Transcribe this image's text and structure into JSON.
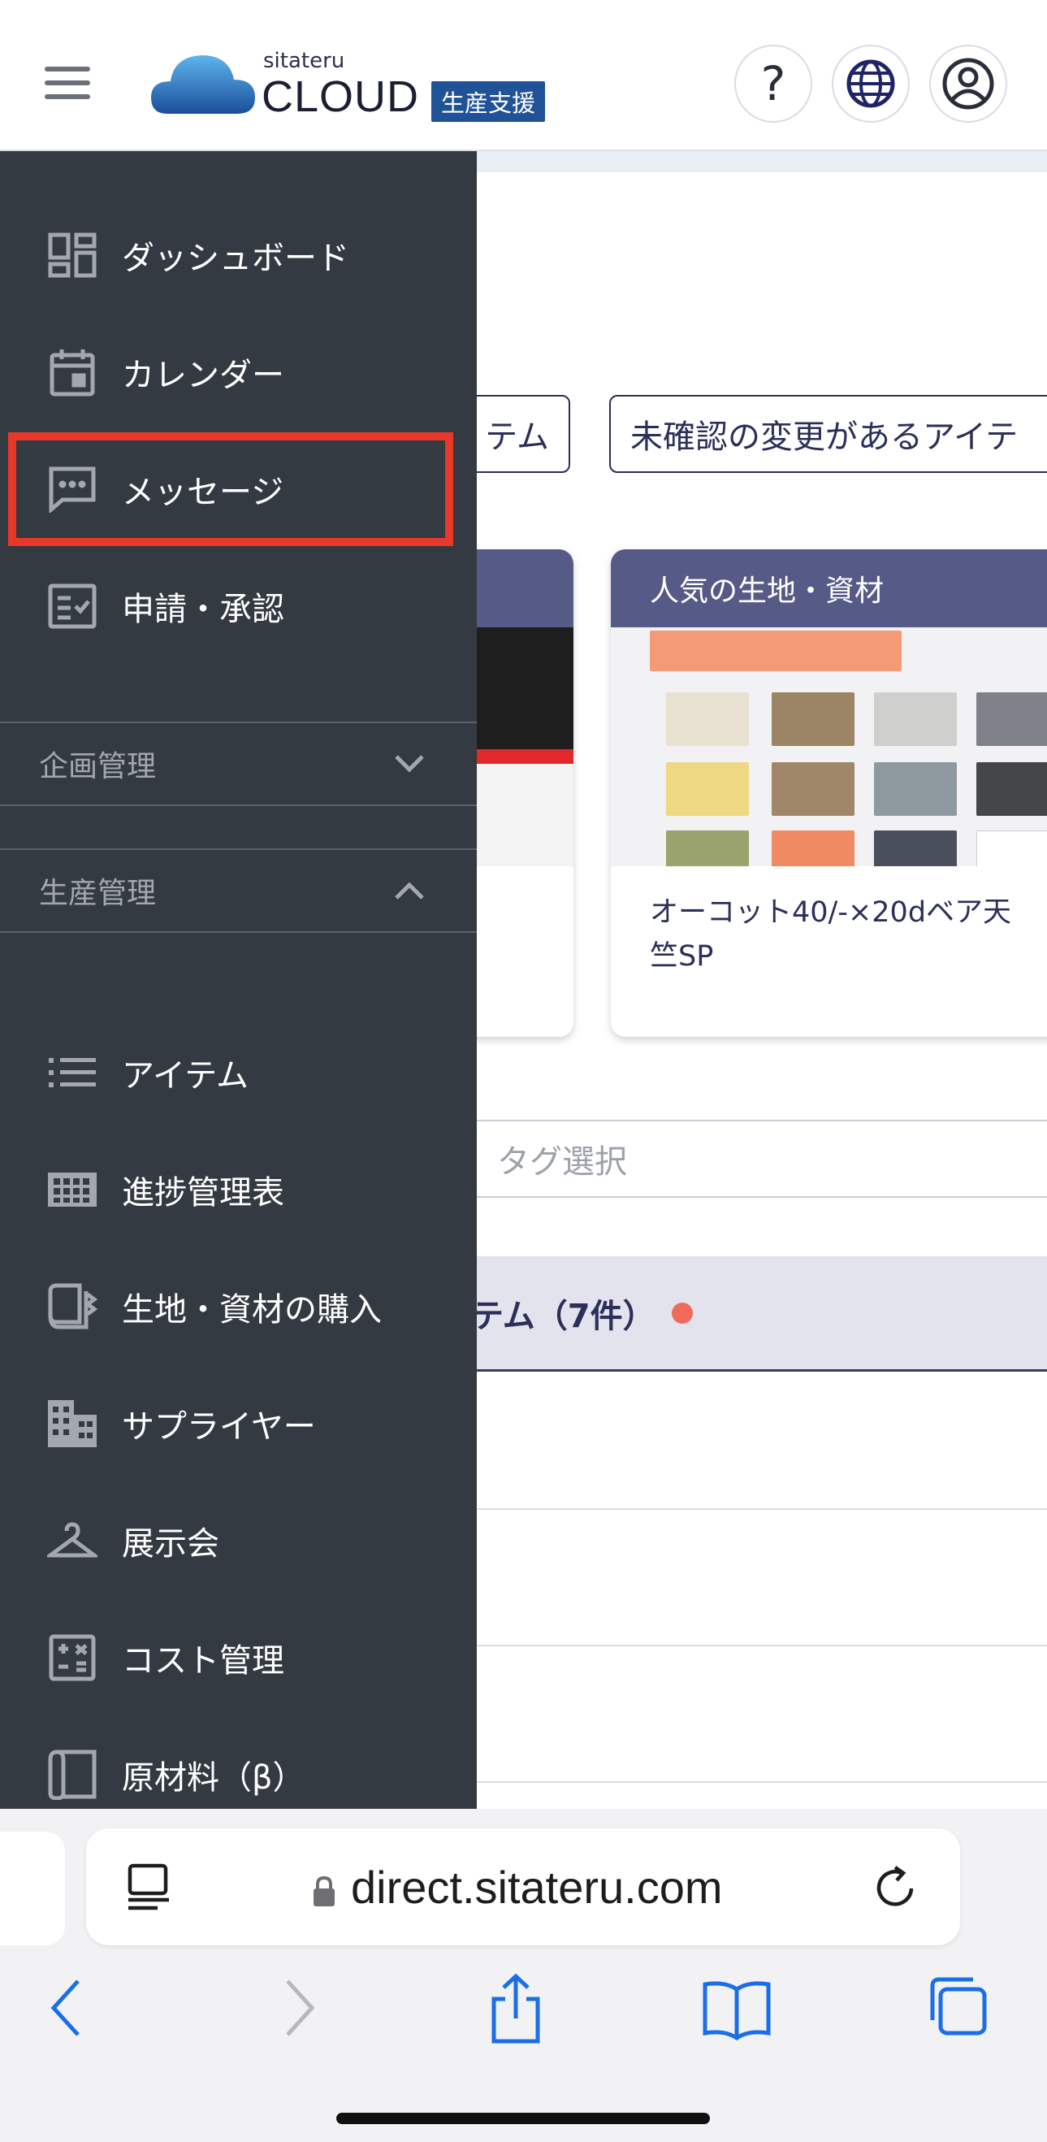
{
  "header": {
    "logo_small": "sitateru",
    "logo_big": "CLOUD",
    "logo_badge": "生産支援",
    "help_label": "?"
  },
  "sidebar": {
    "items_top": [
      {
        "label": "ダッシュボード",
        "icon": "dashboard-icon"
      },
      {
        "label": "カレンダー",
        "icon": "calendar-icon"
      },
      {
        "label": "メッセージ",
        "icon": "message-icon"
      },
      {
        "label": "申請・承認",
        "icon": "approval-icon"
      }
    ],
    "groups": [
      {
        "label": "企画管理",
        "state": "collapsed"
      },
      {
        "label": "生産管理",
        "state": "expanded"
      }
    ],
    "items_production": [
      {
        "label": "アイテム",
        "icon": "list-icon"
      },
      {
        "label": "進捗管理表",
        "icon": "grid-table-icon"
      },
      {
        "label": "生地・資材の購入",
        "icon": "fabric-purchase-icon"
      },
      {
        "label": "サプライヤー",
        "icon": "building-icon"
      },
      {
        "label": "展示会",
        "icon": "hanger-icon"
      },
      {
        "label": "コスト管理",
        "icon": "calculator-icon"
      },
      {
        "label": "原材料（β）",
        "icon": "material-roll-icon"
      }
    ],
    "highlight_color": "#e8382a"
  },
  "background": {
    "chip1": "テム",
    "chip2": "未確認の変更があるアイテ",
    "card_header": "人気の生地・資材",
    "card_title": "オーコット40/-×20dベア天竺SP",
    "search_placeholder": "タグ選択",
    "section_title": "テム（7件）"
  },
  "browser": {
    "url": "direct.sitateru.com"
  },
  "colors": {
    "sidebar_bg": "#343a42",
    "card_header_bg": "#565a86",
    "accent_red": "#e8382a",
    "logo_blue": "#1f5296"
  }
}
